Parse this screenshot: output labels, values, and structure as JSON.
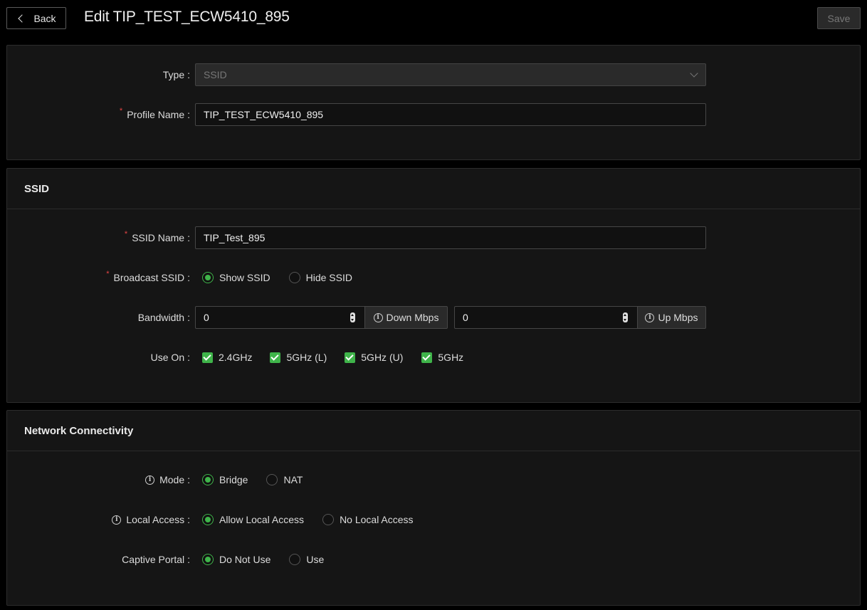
{
  "header": {
    "back_label": "Back",
    "title": "Edit TIP_TEST_ECW5410_895",
    "save_label": "Save"
  },
  "general": {
    "type_label": "Type",
    "type_value": "SSID",
    "profile_name_label": "Profile Name",
    "profile_name_value": "TIP_TEST_ECW5410_895"
  },
  "ssid_section": {
    "heading": "SSID",
    "ssid_name_label": "SSID Name",
    "ssid_name_value": "TIP_Test_895",
    "broadcast_label": "Broadcast SSID",
    "broadcast_options": [
      "Show SSID",
      "Hide SSID"
    ],
    "broadcast_selected": "Show SSID",
    "bandwidth_label": "Bandwidth",
    "down_value": "0",
    "down_unit": "Down Mbps",
    "up_value": "0",
    "up_unit": "Up Mbps",
    "use_on_label": "Use On",
    "use_on_options": [
      "2.4GHz",
      "5GHz (L)",
      "5GHz (U)",
      "5GHz"
    ],
    "use_on_checked": [
      true,
      true,
      true,
      true
    ]
  },
  "network": {
    "heading": "Network Connectivity",
    "mode_label": "Mode",
    "mode_options": [
      "Bridge",
      "NAT"
    ],
    "mode_selected": "Bridge",
    "local_access_label": "Local Access",
    "local_access_options": [
      "Allow Local Access",
      "No Local Access"
    ],
    "local_access_selected": "Allow Local Access",
    "captive_label": "Captive Portal",
    "captive_options": [
      "Do Not Use",
      "Use"
    ],
    "captive_selected": "Do Not Use"
  },
  "colors": {
    "accent": "#3fb44a",
    "required": "#e64545",
    "panel": "#151515",
    "background": "#000000"
  },
  "icons": {
    "back": "chevron-left-icon",
    "dropdown": "chevron-down-icon",
    "info": "info-icon",
    "spinner": "number-spinner-icon",
    "checkbox": "checkmark-icon"
  }
}
